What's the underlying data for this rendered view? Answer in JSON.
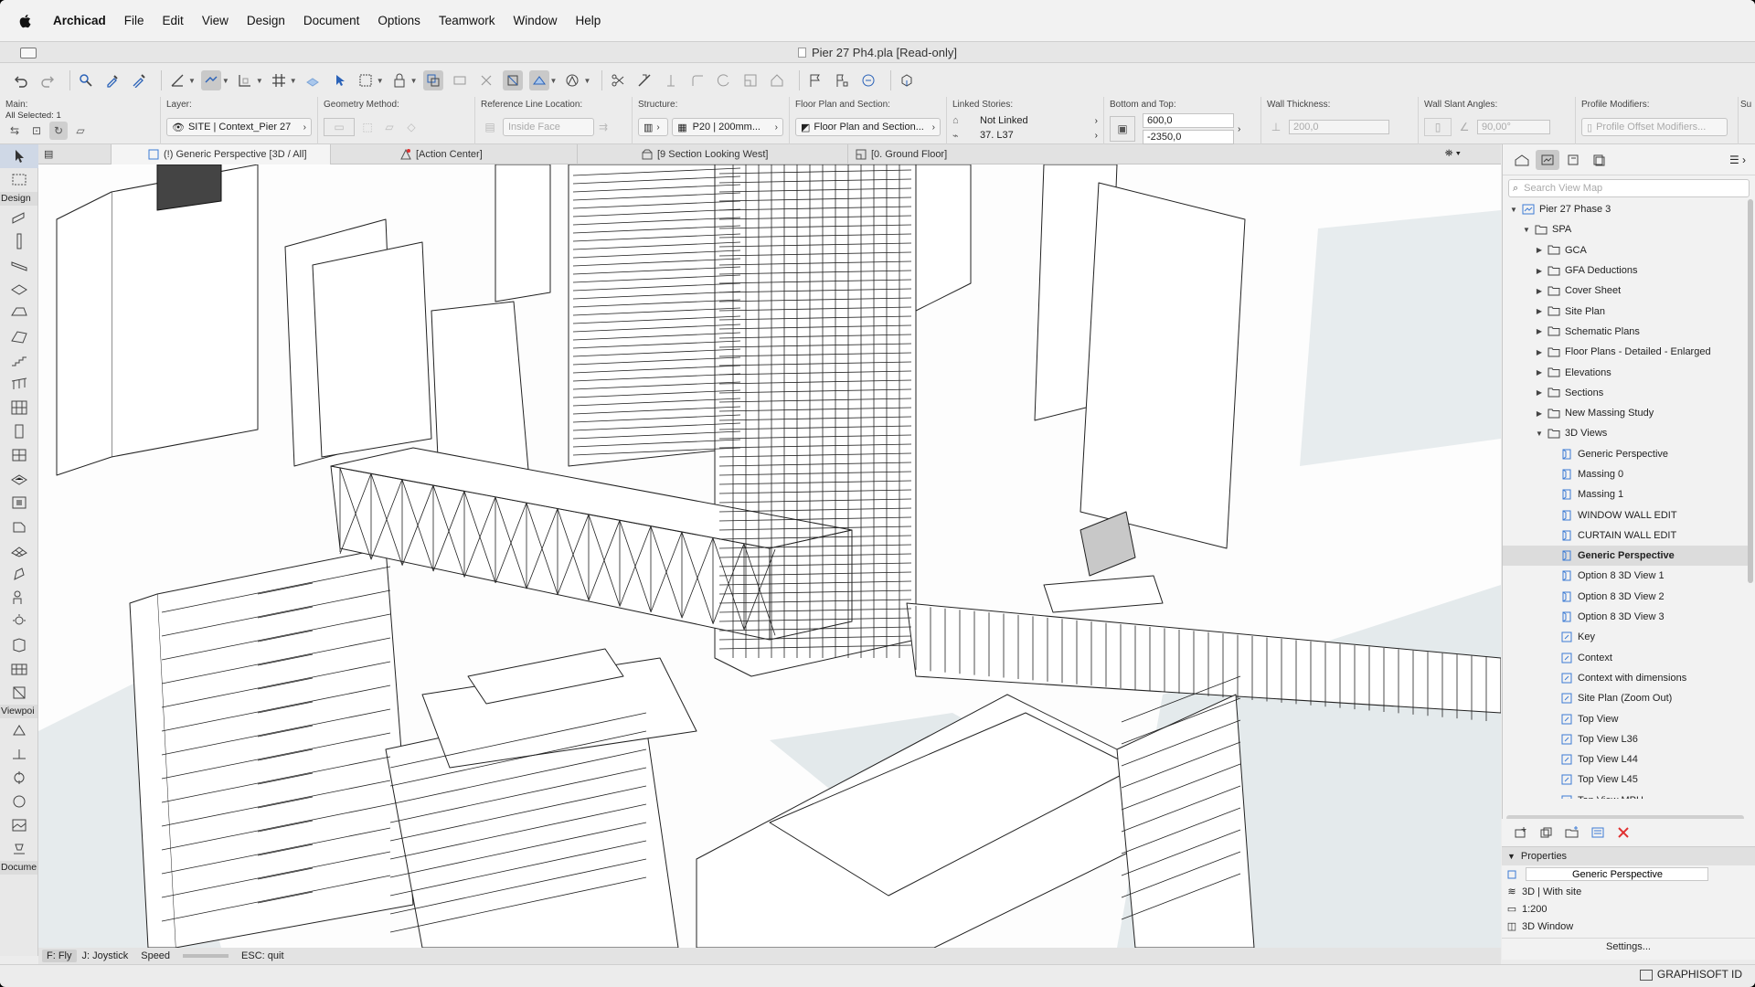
{
  "menubar": {
    "items": [
      "Archicad",
      "File",
      "Edit",
      "View",
      "Design",
      "Document",
      "Options",
      "Teamwork",
      "Window",
      "Help"
    ]
  },
  "window": {
    "title": "Pier 27 Ph4.pla [Read-only]"
  },
  "infobox": {
    "main_label": "Main:",
    "all_selected": "All Selected: 1",
    "layer_label": "Layer:",
    "layer_value": "SITE | Context_Pier 27",
    "geometry_label": "Geometry Method:",
    "refline_label": "Reference Line Location:",
    "refline_value": "Inside Face",
    "structure_label": "Structure:",
    "structure_value": "P20 | 200mm...",
    "fps_label": "Floor Plan and Section:",
    "fps_value": "Floor Plan and Section...",
    "linked_label": "Linked Stories:",
    "linked_top": "Not Linked",
    "linked_bottom": "37. L37",
    "bt_label": "Bottom and Top:",
    "top_value": "600,0",
    "bottom_value": "-2350,0",
    "thick_label": "Wall Thickness:",
    "thick_value": "200,0",
    "slant_label": "Wall Slant Angles:",
    "slant_value": "90,00°",
    "profile_label": "Profile Modifiers:",
    "profile_value": "Profile Offset Modifiers...",
    "su_label": "Su"
  },
  "toolbox": {
    "design": "Design",
    "viewpoint": "Viewpoi",
    "document": "Docume"
  },
  "tabs": [
    {
      "label": "(!) Generic Perspective [3D / All]"
    },
    {
      "label": "[Action Center]"
    },
    {
      "label": "[9 Section Looking West]"
    },
    {
      "label": "[0. Ground Floor]"
    }
  ],
  "status": {
    "fly": "F: Fly",
    "joystick": "J: Joystick",
    "speed": "Speed",
    "quit": "ESC: quit"
  },
  "navigator": {
    "search_placeholder": "Search View Map",
    "items": [
      {
        "label": "Pier 27 Phase 3",
        "level": 0,
        "arrow": "open",
        "icon": "project"
      },
      {
        "label": "SPA",
        "level": 1,
        "arrow": "open",
        "icon": "folder"
      },
      {
        "label": "GCA",
        "level": 2,
        "arrow": "closed",
        "icon": "folder"
      },
      {
        "label": "GFA Deductions",
        "level": 2,
        "arrow": "closed",
        "icon": "folder"
      },
      {
        "label": "Cover Sheet",
        "level": 2,
        "arrow": "closed",
        "icon": "folder"
      },
      {
        "label": "Site Plan",
        "level": 2,
        "arrow": "closed",
        "icon": "folder"
      },
      {
        "label": "Schematic Plans",
        "level": 2,
        "arrow": "closed",
        "icon": "folder"
      },
      {
        "label": "Floor Plans - Detailed - Enlarged",
        "level": 2,
        "arrow": "closed",
        "icon": "folder"
      },
      {
        "label": "Elevations",
        "level": 2,
        "arrow": "closed",
        "icon": "folder"
      },
      {
        "label": "Sections",
        "level": 2,
        "arrow": "closed",
        "icon": "folder"
      },
      {
        "label": "New Massing Study",
        "level": 2,
        "arrow": "closed",
        "icon": "folder"
      },
      {
        "label": "3D Views",
        "level": 2,
        "arrow": "open",
        "icon": "folder"
      },
      {
        "label": "Generic Perspective",
        "level": 3,
        "icon": "perspective"
      },
      {
        "label": "Massing 0",
        "level": 3,
        "icon": "perspective"
      },
      {
        "label": "Massing 1",
        "level": 3,
        "icon": "perspective"
      },
      {
        "label": "WINDOW WALL EDIT",
        "level": 3,
        "icon": "perspective"
      },
      {
        "label": "CURTAIN WALL EDIT",
        "level": 3,
        "icon": "perspective"
      },
      {
        "label": "Generic Perspective",
        "level": 3,
        "icon": "perspective",
        "selected": true
      },
      {
        "label": "Option 8 3D View 1",
        "level": 3,
        "icon": "perspective"
      },
      {
        "label": "Option 8 3D View 2",
        "level": 3,
        "icon": "perspective"
      },
      {
        "label": "Option 8 3D View 3",
        "level": 3,
        "icon": "perspective"
      },
      {
        "label": "Key",
        "level": 3,
        "icon": "axon"
      },
      {
        "label": "Context",
        "level": 3,
        "icon": "axon"
      },
      {
        "label": "Context with dimensions",
        "level": 3,
        "icon": "axon"
      },
      {
        "label": "Site Plan (Zoom Out)",
        "level": 3,
        "icon": "axon"
      },
      {
        "label": "Top View",
        "level": 3,
        "icon": "axon"
      },
      {
        "label": "Top View L36",
        "level": 3,
        "icon": "axon"
      },
      {
        "label": "Top View L44",
        "level": 3,
        "icon": "axon"
      },
      {
        "label": "Top View L45",
        "level": 3,
        "icon": "axon"
      },
      {
        "label": "Top View MPH",
        "level": 3,
        "icon": "axon"
      }
    ]
  },
  "properties": {
    "title": "Properties",
    "name": "Generic Perspective",
    "model": "3D | With site",
    "scale": "1:200",
    "window": "3D Window",
    "settings": "Settings..."
  },
  "brand": "GRAPHISOFT ID",
  "colors": {
    "delete": "#e03030",
    "selection": "#cfd8e6"
  }
}
